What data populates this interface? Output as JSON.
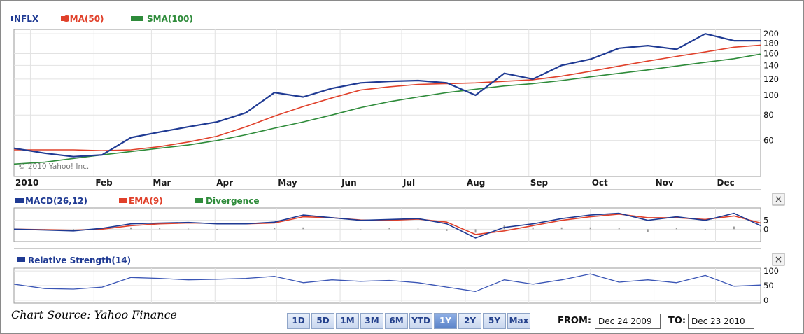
{
  "chart_data": [
    {
      "type": "line",
      "legend": [
        "NFLX",
        "SMA(50)",
        "SMA(100)"
      ],
      "year_label": "2010",
      "x_tick_labels": [
        "Feb",
        "Mar",
        "Apr",
        "May",
        "Jun",
        "Jul",
        "Aug",
        "Sep",
        "Oct",
        "Nov",
        "Dec"
      ],
      "y_tick_labels": [
        "200",
        "180",
        "160",
        "140",
        "120",
        "100",
        "80",
        "60"
      ],
      "y_scale": "log",
      "ylim": [
        40,
        210
      ],
      "watermark": "© 2010 Yahoo! Inc.",
      "grid": true,
      "x": [
        "2009-12-24",
        "2010-01-08",
        "2010-01-22",
        "2010-02-05",
        "2010-02-19",
        "2010-03-05",
        "2010-03-19",
        "2010-04-02",
        "2010-04-16",
        "2010-04-30",
        "2010-05-14",
        "2010-05-28",
        "2010-06-11",
        "2010-06-25",
        "2010-07-09",
        "2010-07-23",
        "2010-08-06",
        "2010-08-20",
        "2010-09-03",
        "2010-09-17",
        "2010-10-01",
        "2010-10-15",
        "2010-10-29",
        "2010-11-12",
        "2010-11-26",
        "2010-12-10",
        "2010-12-23"
      ],
      "series": [
        {
          "name": "NFLX",
          "color": "#1f3a93",
          "values": [
            55,
            52,
            50,
            51,
            62,
            66,
            70,
            74,
            82,
            103,
            98,
            108,
            115,
            117,
            118,
            115,
            100,
            128,
            120,
            140,
            150,
            170,
            175,
            168,
            200,
            185,
            185
          ]
        },
        {
          "name": "SMA(50)",
          "color": "#e0402a",
          "values": [
            54,
            54,
            54,
            53.5,
            54,
            56,
            59,
            63,
            70,
            79,
            88,
            97,
            106,
            110,
            113,
            114,
            115,
            117,
            119,
            124,
            131,
            139,
            147,
            155,
            163,
            172,
            176
          ]
        },
        {
          "name": "SMA(100)",
          "color": "#2e8b3a",
          "values": [
            46,
            47,
            49,
            51,
            53,
            55,
            57,
            60,
            64,
            69,
            74,
            80,
            87,
            93,
            98,
            103,
            107,
            111,
            114,
            118,
            123,
            128,
            133,
            139,
            145,
            151,
            159
          ]
        }
      ]
    },
    {
      "type": "line",
      "legend": [
        "MACD(26,12)",
        "EMA(9)",
        "Divergence"
      ],
      "y_tick_labels": [
        "5",
        "0"
      ],
      "ylim": [
        -7,
        12
      ],
      "x": [
        "2009-12-24",
        "2010-01-08",
        "2010-01-22",
        "2010-02-05",
        "2010-02-19",
        "2010-03-05",
        "2010-03-19",
        "2010-04-02",
        "2010-04-16",
        "2010-04-30",
        "2010-05-14",
        "2010-05-28",
        "2010-06-11",
        "2010-06-25",
        "2010-07-09",
        "2010-07-23",
        "2010-08-06",
        "2010-08-20",
        "2010-09-03",
        "2010-09-17",
        "2010-10-01",
        "2010-10-15",
        "2010-10-29",
        "2010-11-12",
        "2010-11-26",
        "2010-12-10",
        "2010-12-23"
      ],
      "series": [
        {
          "name": "MACD(26,12)",
          "color": "#1f3a93",
          "values": [
            0,
            -0.5,
            -1,
            0.5,
            3,
            3.5,
            3.8,
            3,
            3,
            4,
            8,
            6.5,
            5,
            5.5,
            6,
            3,
            -5,
            1,
            3,
            6,
            8,
            9,
            5,
            7,
            5,
            9,
            2
          ]
        },
        {
          "name": "EMA(9)",
          "color": "#e0402a",
          "values": [
            0,
            -0.3,
            -0.6,
            0,
            2,
            3,
            3.5,
            3.3,
            3,
            3.5,
            7,
            6.5,
            5.2,
            5,
            5.7,
            4,
            -3,
            -1,
            2,
            5,
            7,
            8.5,
            6.5,
            6.5,
            5.5,
            7.5,
            3.5
          ]
        },
        {
          "name": "Divergence",
          "color": "#999999",
          "values": [
            0,
            -0.3,
            -0.4,
            0.5,
            1,
            0.5,
            0.3,
            -0.3,
            0,
            0.5,
            1,
            0,
            -0.2,
            0.5,
            0.3,
            -1,
            -2,
            2,
            1,
            1,
            1,
            0.5,
            -1.5,
            0.5,
            -0.5,
            1.5,
            -1.5
          ]
        }
      ]
    },
    {
      "type": "line",
      "legend": [
        "Relative Strength(14)"
      ],
      "y_tick_labels": [
        "100",
        "50",
        "0"
      ],
      "ylim": [
        -10,
        110
      ],
      "x": [
        "2009-12-24",
        "2010-01-08",
        "2010-01-22",
        "2010-02-05",
        "2010-02-19",
        "2010-03-05",
        "2010-03-19",
        "2010-04-02",
        "2010-04-16",
        "2010-04-30",
        "2010-05-14",
        "2010-05-28",
        "2010-06-11",
        "2010-06-25",
        "2010-07-09",
        "2010-07-23",
        "2010-08-06",
        "2010-08-20",
        "2010-09-03",
        "2010-09-17",
        "2010-10-01",
        "2010-10-15",
        "2010-10-29",
        "2010-11-12",
        "2010-11-26",
        "2010-12-10",
        "2010-12-23"
      ],
      "series": [
        {
          "name": "Relative Strength(14)",
          "color": "#3a55b5",
          "values": [
            55,
            40,
            38,
            45,
            78,
            75,
            70,
            72,
            75,
            82,
            60,
            70,
            65,
            68,
            60,
            45,
            30,
            70,
            55,
            70,
            90,
            62,
            70,
            60,
            85,
            48,
            52
          ]
        }
      ]
    }
  ],
  "controls": {
    "source": "Chart Source: Yahoo Finance",
    "ranges": [
      "1D",
      "5D",
      "1M",
      "3M",
      "6M",
      "YTD",
      "1Y",
      "2Y",
      "5Y",
      "Max"
    ],
    "selected_range": "1Y",
    "from_label": "FROM:",
    "from_value": "Dec 24 2009",
    "to_label": "TO:",
    "to_value": "Dec 23 2010",
    "close_glyph": "×"
  }
}
